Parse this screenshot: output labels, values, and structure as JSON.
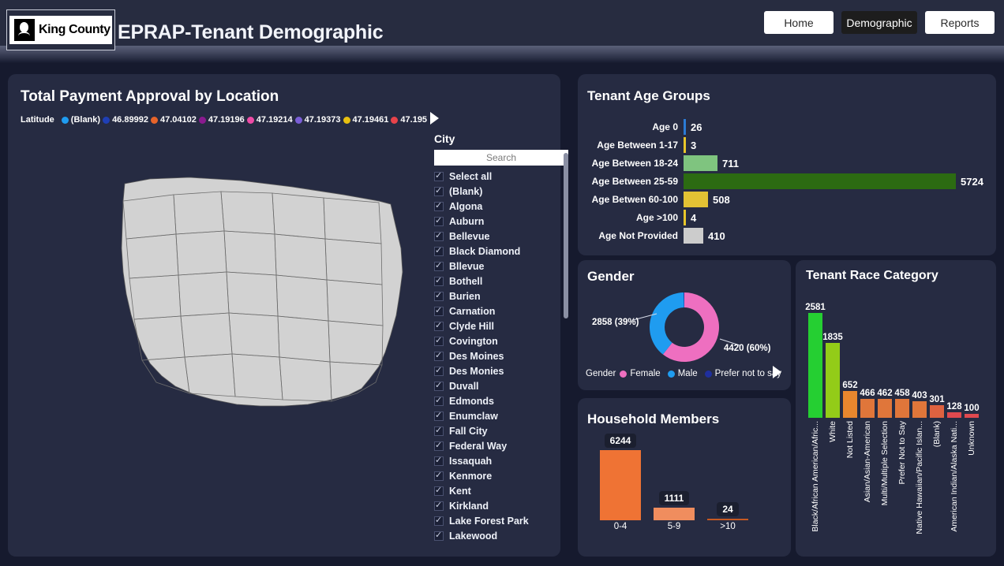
{
  "header": {
    "logo_text": "King County",
    "title": "EPRAP-Tenant Demographic",
    "nav": [
      {
        "label": "Home",
        "active": false
      },
      {
        "label": "Demographic",
        "active": true
      },
      {
        "label": "Reports",
        "active": false
      }
    ]
  },
  "map_card": {
    "title": "Total Payment Approval by Location",
    "legend_label": "Latitude",
    "legend": [
      {
        "label": "(Blank)",
        "color": "#1f9cf0"
      },
      {
        "label": "46.89992",
        "color": "#1f3fb5"
      },
      {
        "label": "47.04102",
        "color": "#e8642a"
      },
      {
        "label": "47.19196",
        "color": "#8a1a8f"
      },
      {
        "label": "47.19214",
        "color": "#ee4ba6"
      },
      {
        "label": "47.19373",
        "color": "#7a5ed6"
      },
      {
        "label": "47.19461",
        "color": "#e8c010"
      },
      {
        "label": "47.195",
        "color": "#e8434a"
      }
    ]
  },
  "slicer": {
    "title": "City",
    "search_placeholder": "Search",
    "items": [
      "Select all",
      "(Blank)",
      "Algona",
      "Auburn",
      "Bellevue",
      "Black Diamond",
      "Bllevue",
      "Bothell",
      "Burien",
      "Carnation",
      "Clyde Hill",
      "Covington",
      "Des Moines",
      "Des Monies",
      "Duvall",
      "Edmonds",
      "Enumclaw",
      "Fall City",
      "Federal Way",
      "Issaquah",
      "Kenmore",
      "Kent",
      "Kirkland",
      "Lake Forest Park",
      "Lakewood"
    ]
  },
  "chart_data": [
    {
      "type": "bar",
      "orientation": "horizontal",
      "title": "Tenant Age Groups",
      "categories": [
        "Age 0",
        "Age Between 1-17",
        "Age Between 18-24",
        "Age Between 25-59",
        "Age Betwen 60-100",
        "Age >100",
        "Age Not Provided"
      ],
      "values": [
        26,
        3,
        711,
        5724,
        508,
        4,
        410
      ],
      "colors": [
        "#2b7bd6",
        "#e8c62a",
        "#7fc47f",
        "#2c6b12",
        "#e3c234",
        "#e8c62a",
        "#cccccc"
      ],
      "xlabel": "",
      "ylabel": "",
      "xlim": [
        0,
        5724
      ],
      "grid": false
    },
    {
      "type": "pie",
      "subtype": "donut",
      "title": "Gender",
      "legend_label": "Gender",
      "legend_position": "bottom",
      "categories": [
        "Female",
        "Male",
        "Prefer not to say"
      ],
      "values": [
        4420,
        2858,
        20
      ],
      "labels": [
        "4420 (60%)",
        "2858 (39%)",
        ""
      ],
      "colors": [
        "#ee6fc0",
        "#1f9cf0",
        "#1f2f9e"
      ]
    },
    {
      "type": "bar",
      "orientation": "vertical",
      "title": "Household Members",
      "categories": [
        "0-4",
        "5-9",
        ">10"
      ],
      "values": [
        6244,
        1111,
        24
      ],
      "colors": [
        "#ef7334",
        "#f08d5e",
        "#c75a22"
      ],
      "xlabel": "",
      "ylabel": "",
      "ylim": [
        0,
        6244
      ],
      "grid": false
    },
    {
      "type": "bar",
      "orientation": "vertical",
      "title": "Tenant Race Category",
      "categories": [
        "Black/African American/Afric...",
        "White",
        "Not Listed",
        "Asian/Asian-American",
        "Multi/Multiple Selection",
        "Prefer Not to Say",
        "Native Hawaiian/Pacific Islan...",
        "(Blank)",
        "American Indian/Alaska Nati...",
        "Unknown"
      ],
      "values": [
        2581,
        1835,
        652,
        466,
        462,
        458,
        403,
        301,
        128,
        100
      ],
      "colors": [
        "#25cf32",
        "#93cc18",
        "#e8872e",
        "#e0763a",
        "#e0763a",
        "#e0763a",
        "#e0763a",
        "#de6240",
        "#e0494f",
        "#e0494f"
      ],
      "xlabel": "",
      "ylabel": "",
      "ylim": [
        0,
        2581
      ],
      "grid": false
    }
  ]
}
